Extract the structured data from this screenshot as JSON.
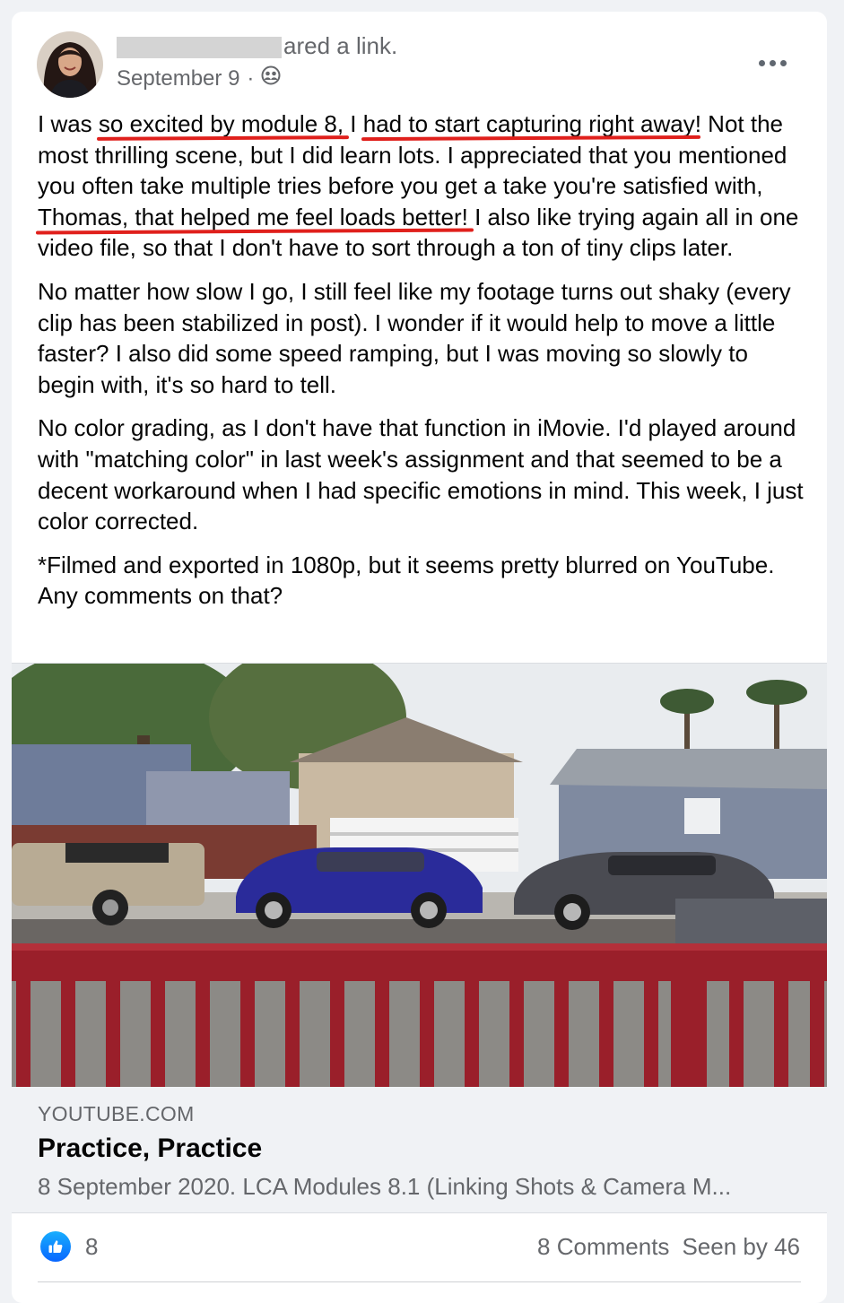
{
  "post": {
    "header_action": "ared a link.",
    "date": "September 9",
    "dot": "·",
    "privacy_icon": "group-icon",
    "more_icon": "more-horizontal-icon"
  },
  "body": {
    "p1_a": "I was ",
    "p1_hl1": "so excited by module 8,",
    "p1_b": " I ",
    "p1_hl2": "had to start capturing right away",
    "p1_c": "! Not the most thrilling scene, but I did learn lots. I appreciated that you mentioned you often take multiple tries before you get a take you're satisfied with, ",
    "p1_hl3": "Thomas, that helped me feel loads better!",
    "p1_d": " I also like trying again all in one video file, so that I don't have to sort through a ton of tiny clips later.",
    "p2": "No matter how slow I go, I still feel like my footage turns out shaky (every clip has been stabilized in post). I wonder if it would help to move a little faster? I also did some speed ramping, but I was moving so slowly to begin with, it's so hard to tell.",
    "p3": "No color grading, as I don't have that function in iMovie. I'd played around with \"matching color\" in last week's assignment and that seemed to be a decent workaround when I had specific emotions in mind. This week, I just color corrected.",
    "p4": "*Filmed and exported in 1080p, but it seems pretty blurred on YouTube. Any comments on that?"
  },
  "link": {
    "domain": "YOUTUBE.COM",
    "title": "Practice, Practice",
    "description": "8 September 2020. LCA Modules 8.1 (Linking Shots & Camera M..."
  },
  "footer": {
    "like_icon": "like-thumb-icon",
    "like_count": "8",
    "comments": "8 Comments",
    "seen": "Seen by 46"
  },
  "colors": {
    "highlight_underline": "#e0201c",
    "like_blue": "#0866ff",
    "secondary_text": "#65676b",
    "railing_red": "#9a1f2a"
  }
}
